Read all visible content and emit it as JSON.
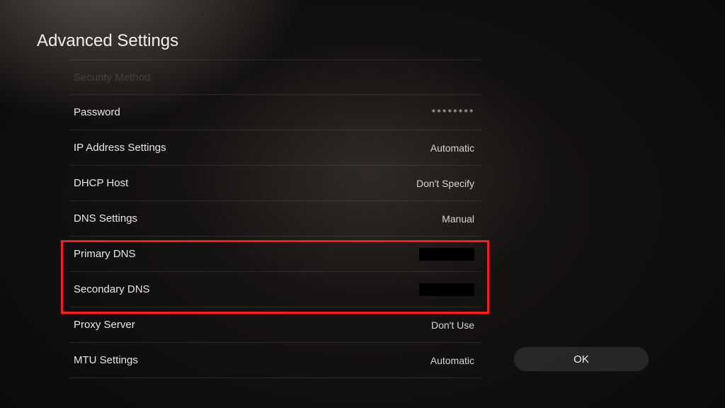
{
  "page": {
    "title": "Advanced Settings"
  },
  "rows": {
    "security_method": {
      "label": "Security Method",
      "value": ""
    },
    "password": {
      "label": "Password",
      "value": "********"
    },
    "ip_settings": {
      "label": "IP Address Settings",
      "value": "Automatic"
    },
    "dhcp_host": {
      "label": "DHCP Host",
      "value": "Don't Specify"
    },
    "dns_settings": {
      "label": "DNS Settings",
      "value": "Manual"
    },
    "primary_dns": {
      "label": "Primary DNS",
      "value": ""
    },
    "secondary_dns": {
      "label": "Secondary DNS",
      "value": ""
    },
    "proxy_server": {
      "label": "Proxy Server",
      "value": "Don't Use"
    },
    "mtu_settings": {
      "label": "MTU Settings",
      "value": "Automatic"
    }
  },
  "buttons": {
    "ok": "OK"
  },
  "annotation": {
    "highlighted": [
      "primary_dns",
      "secondary_dns"
    ]
  }
}
